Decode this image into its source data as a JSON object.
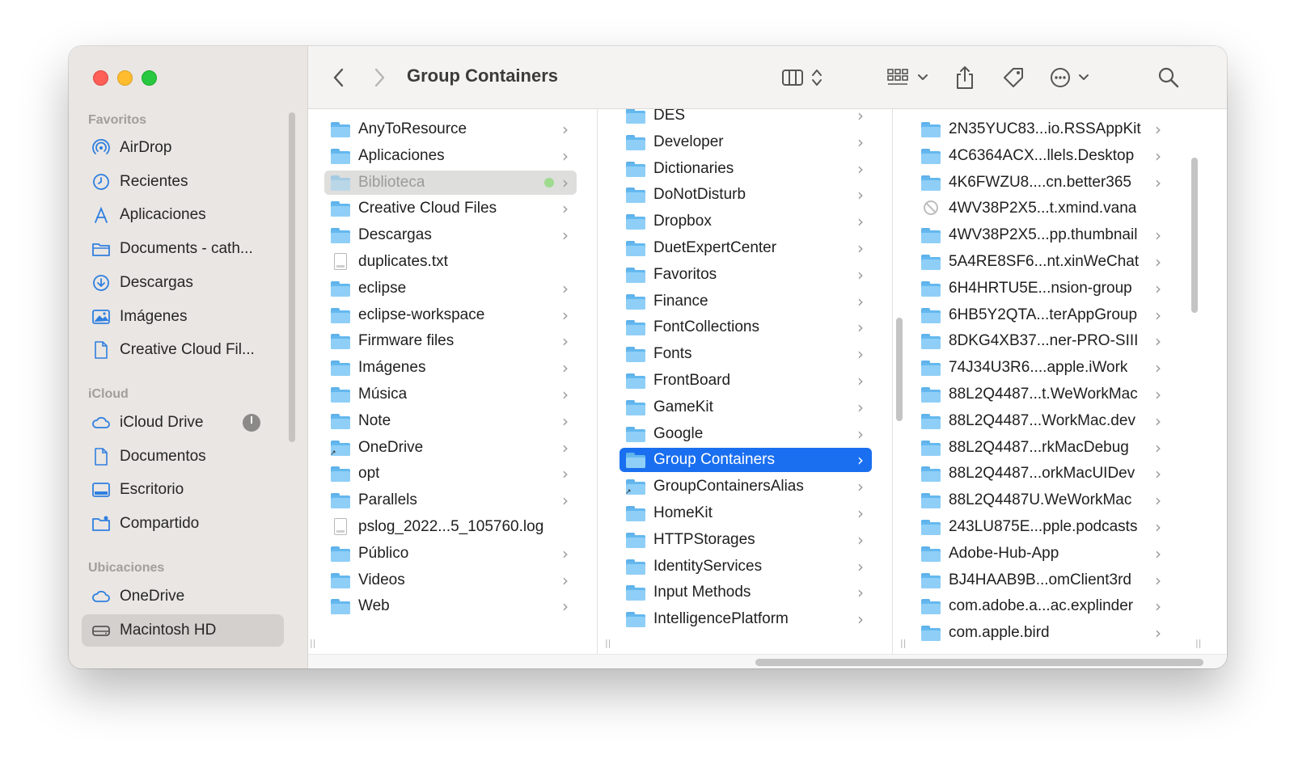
{
  "window": {
    "title": "Group Containers"
  },
  "sidebar": {
    "favorites_header": "Favoritos",
    "favorites": [
      {
        "label": "AirDrop",
        "icon": "airdrop-icon"
      },
      {
        "label": "Recientes",
        "icon": "clock-icon"
      },
      {
        "label": "Aplicaciones",
        "icon": "applications-icon"
      },
      {
        "label": "Documents - cath...",
        "icon": "folder-icon"
      },
      {
        "label": "Descargas",
        "icon": "download-icon"
      },
      {
        "label": "Imágenes",
        "icon": "photo-icon"
      },
      {
        "label": "Creative Cloud Fil...",
        "icon": "document-icon"
      }
    ],
    "icloud_header": "iCloud",
    "icloud": [
      {
        "label": "iCloud Drive",
        "icon": "cloud-icon"
      },
      {
        "label": "Documentos",
        "icon": "document-icon"
      },
      {
        "label": "Escritorio",
        "icon": "desktop-icon"
      },
      {
        "label": "Compartido",
        "icon": "shared-folder-icon"
      }
    ],
    "locations_header": "Ubicaciones",
    "locations": [
      {
        "label": "OneDrive",
        "icon": "cloud-icon"
      },
      {
        "label": "Macintosh HD",
        "icon": "disk-icon",
        "selected": true
      }
    ]
  },
  "toolbar": {
    "back": "back-chevron-icon",
    "forward": "forward-chevron-icon",
    "view": "column-view-icon",
    "group": "group-grid-icon",
    "share": "share-icon",
    "tag": "tag-icon",
    "more": "ellipsis-circle-icon",
    "search": "search-icon"
  },
  "columns": [
    {
      "items": [
        {
          "name": "AnyToResource",
          "type": "folder",
          "chevron": true
        },
        {
          "name": "Aplicaciones",
          "type": "folder",
          "chevron": true
        },
        {
          "name": "Biblioteca",
          "type": "folder",
          "chevron": true,
          "state": "dim",
          "status": "green-dot"
        },
        {
          "name": "Creative Cloud Files",
          "type": "folder",
          "chevron": true
        },
        {
          "name": "Descargas",
          "type": "folder",
          "chevron": true
        },
        {
          "name": "duplicates.txt",
          "type": "doc",
          "chevron": false
        },
        {
          "name": "eclipse",
          "type": "folder",
          "chevron": true
        },
        {
          "name": "eclipse-workspace",
          "type": "folder",
          "chevron": true
        },
        {
          "name": "Firmware files",
          "type": "folder",
          "chevron": true
        },
        {
          "name": "Imágenes",
          "type": "folder",
          "chevron": true
        },
        {
          "name": "Música",
          "type": "folder",
          "chevron": true
        },
        {
          "name": "Note",
          "type": "folder",
          "chevron": true
        },
        {
          "name": "OneDrive",
          "type": "alias",
          "chevron": true
        },
        {
          "name": "opt",
          "type": "folder",
          "chevron": true
        },
        {
          "name": "Parallels",
          "type": "folder",
          "chevron": true
        },
        {
          "name": "pslog_2022...5_105760.log",
          "type": "doc",
          "chevron": false
        },
        {
          "name": "Público",
          "type": "folder",
          "chevron": true
        },
        {
          "name": "Videos",
          "type": "folder",
          "chevron": true
        },
        {
          "name": "Web",
          "type": "folder",
          "chevron": true
        }
      ]
    },
    {
      "items": [
        {
          "name": "DES",
          "type": "folder",
          "chevron": true
        },
        {
          "name": "Developer",
          "type": "folder",
          "chevron": true
        },
        {
          "name": "Dictionaries",
          "type": "folder",
          "chevron": true
        },
        {
          "name": "DoNotDisturb",
          "type": "folder",
          "chevron": true
        },
        {
          "name": "Dropbox",
          "type": "folder",
          "chevron": true
        },
        {
          "name": "DuetExpertCenter",
          "type": "folder",
          "chevron": true
        },
        {
          "name": "Favoritos",
          "type": "folder",
          "chevron": true
        },
        {
          "name": "Finance",
          "type": "folder",
          "chevron": true
        },
        {
          "name": "FontCollections",
          "type": "folder",
          "chevron": true
        },
        {
          "name": "Fonts",
          "type": "folder",
          "chevron": true
        },
        {
          "name": "FrontBoard",
          "type": "folder",
          "chevron": true
        },
        {
          "name": "GameKit",
          "type": "folder",
          "chevron": true
        },
        {
          "name": "Google",
          "type": "folder",
          "chevron": true
        },
        {
          "name": "Group Containers",
          "type": "folder",
          "chevron": true,
          "state": "selected"
        },
        {
          "name": "GroupContainersAlias",
          "type": "alias",
          "chevron": true
        },
        {
          "name": "HomeKit",
          "type": "folder",
          "chevron": true
        },
        {
          "name": "HTTPStorages",
          "type": "folder",
          "chevron": true
        },
        {
          "name": "IdentityServices",
          "type": "folder",
          "chevron": true
        },
        {
          "name": "Input Methods",
          "type": "folder",
          "chevron": true
        },
        {
          "name": "IntelligencePlatform",
          "type": "folder",
          "chevron": true
        }
      ]
    },
    {
      "items": [
        {
          "name": "2N35YUC83...io.RSSAppKit",
          "type": "folder",
          "chevron": true
        },
        {
          "name": "4C6364ACX...llels.Desktop",
          "type": "folder",
          "chevron": true
        },
        {
          "name": "4K6FWZU8....cn.better365",
          "type": "folder",
          "chevron": true
        },
        {
          "name": "4WV38P2X5...t.xmind.vana",
          "type": "noentry",
          "chevron": false
        },
        {
          "name": "4WV38P2X5...pp.thumbnail",
          "type": "folder",
          "chevron": true
        },
        {
          "name": "5A4RE8SF6...nt.xinWeChat",
          "type": "folder",
          "chevron": true
        },
        {
          "name": "6H4HRTU5E...nsion-group",
          "type": "folder",
          "chevron": true
        },
        {
          "name": "6HB5Y2QTA...terAppGroup",
          "type": "folder",
          "chevron": true
        },
        {
          "name": "8DKG4XB37...ner-PRO-SIII",
          "type": "folder",
          "chevron": true
        },
        {
          "name": "74J34U3R6....apple.iWork",
          "type": "folder",
          "chevron": true
        },
        {
          "name": "88L2Q4487...t.WeWorkMac",
          "type": "folder",
          "chevron": true
        },
        {
          "name": "88L2Q4487...WorkMac.dev",
          "type": "folder",
          "chevron": true
        },
        {
          "name": "88L2Q4487...rkMacDebug",
          "type": "folder",
          "chevron": true
        },
        {
          "name": "88L2Q4487...orkMacUIDev",
          "type": "folder",
          "chevron": true
        },
        {
          "name": "88L2Q4487U.WeWorkMac",
          "type": "folder",
          "chevron": true
        },
        {
          "name": "243LU875E...pple.podcasts",
          "type": "folder",
          "chevron": true
        },
        {
          "name": "Adobe-Hub-App",
          "type": "folder",
          "chevron": true
        },
        {
          "name": "BJ4HAAB9B...omClient3rd",
          "type": "folder",
          "chevron": true
        },
        {
          "name": "com.adobe.a...ac.explinder",
          "type": "folder",
          "chevron": true
        },
        {
          "name": "com.apple.bird",
          "type": "folder",
          "chevron": true
        }
      ]
    }
  ],
  "colors": {
    "accent": "#1a6ff0",
    "folder": "#64b8ef",
    "sidebar_bg": "#e9e6e3"
  }
}
